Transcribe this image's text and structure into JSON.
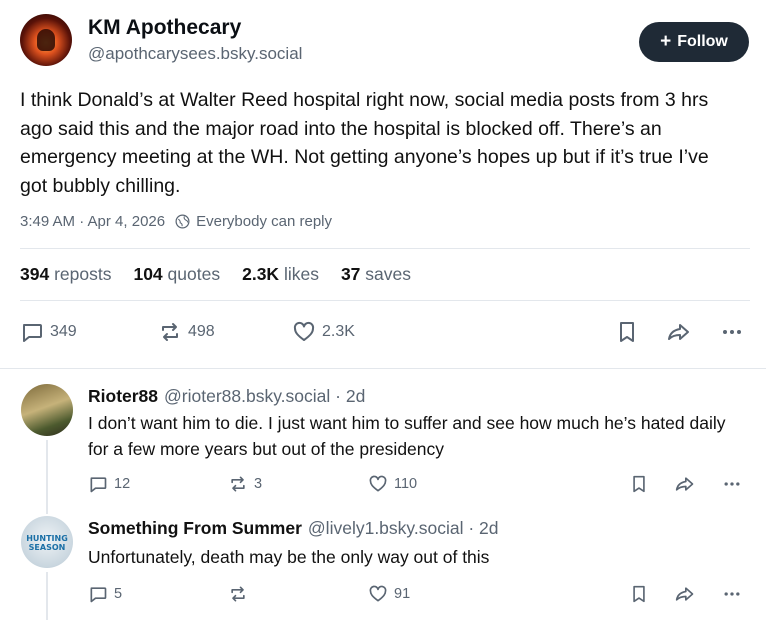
{
  "post": {
    "author_name": "KM Apothecary",
    "author_handle": "@apothcarysees.bsky.social",
    "follow_label": "+ Follow",
    "follow_plus": "+",
    "follow_text": "Follow",
    "text": "I think Donald’s at Walter Reed hospital right now, social media posts from 3 hrs ago said this and the major road into the hospital is blocked off. There’s an emergency meeting at the WH. Not getting anyone’s hopes up but if it’s true I’ve got bubbly chilling.",
    "timestamp": "3:49 AM · Apr 4, 2026",
    "reply_setting": "Everybody can reply",
    "stats": {
      "reposts_count": "394",
      "reposts_label": "reposts",
      "quotes_count": "104",
      "quotes_label": "quotes",
      "likes_count": "2.3K",
      "likes_label": "likes",
      "saves_count": "37",
      "saves_label": "saves"
    },
    "actions": {
      "replies": "349",
      "reposts": "498",
      "likes": "2.3K"
    }
  },
  "replies": [
    {
      "name": "Rioter88",
      "handle_time": "@rioter88.bsky.social · 2d",
      "text": "I don’t want him to die.  I just want him to suffer and see how much he’s hated daily for a few more years but out of the presidency",
      "replies": "12",
      "reposts": "3",
      "likes": "110"
    },
    {
      "name": "Something From Summer",
      "handle_time": "@lively1.bsky.social · 2d",
      "text": "Unfortunately, death may be the only way out of this",
      "avatar_text": "HUNTING SEASON",
      "replies": "5",
      "reposts": "",
      "likes": "91"
    }
  ],
  "colors": {
    "accent_button": "#1f2a36",
    "muted_text": "#5a6572",
    "divider": "#e3e7ec"
  },
  "icons": [
    "reply-icon",
    "repost-icon",
    "like-icon",
    "bookmark-icon",
    "share-icon",
    "more-icon",
    "globe-icon"
  ]
}
